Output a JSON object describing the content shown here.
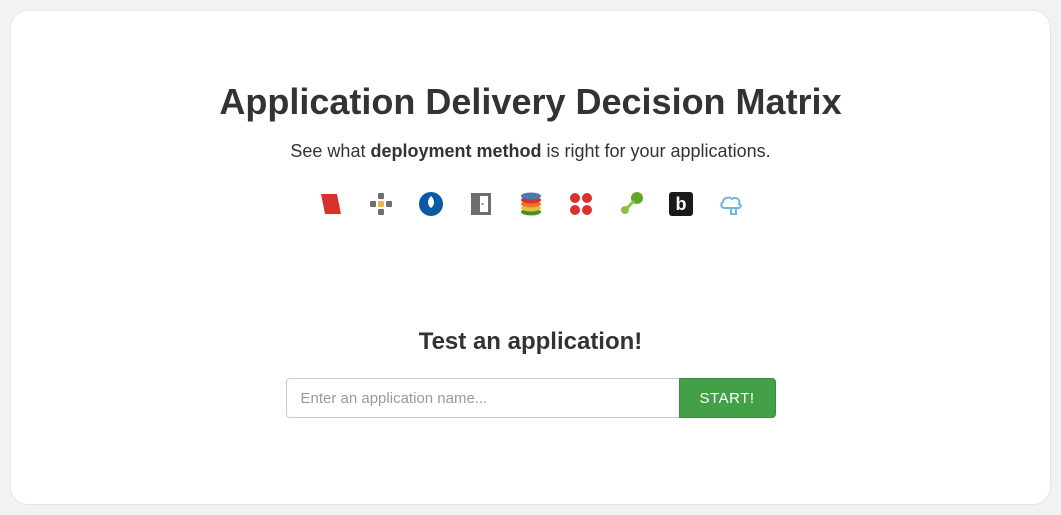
{
  "header": {
    "title": "Application Delivery Decision Matrix",
    "subtitle_prefix": "See what ",
    "subtitle_bold": "deployment method",
    "subtitle_suffix": " is right for your applications."
  },
  "icons": [
    {
      "name": "thinapp-icon"
    },
    {
      "name": "plus-icon"
    },
    {
      "name": "flame-circle-icon"
    },
    {
      "name": "door-icon"
    },
    {
      "name": "layers-icon"
    },
    {
      "name": "four-dots-icon"
    },
    {
      "name": "green-dots-icon"
    },
    {
      "name": "letter-b-icon"
    },
    {
      "name": "cloud-icon"
    }
  ],
  "test": {
    "heading": "Test an application!",
    "input_placeholder": "Enter an application name...",
    "input_value": "",
    "button_label": "START!"
  },
  "colors": {
    "accent_button": "#43a047",
    "red": "#d9322c",
    "blue": "#0b5aa5",
    "grey": "#6f6f6f",
    "green": "#7bbf2e",
    "cloud": "#6cb7e6"
  }
}
